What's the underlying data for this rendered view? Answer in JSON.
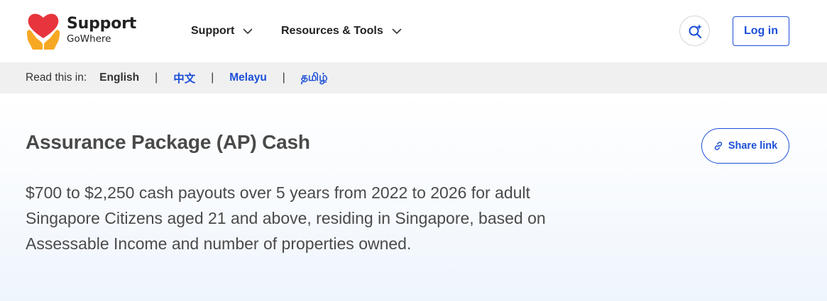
{
  "header": {
    "logo": {
      "line1": "Support",
      "line2": "GoWhere"
    },
    "nav": [
      {
        "label": "Support"
      },
      {
        "label": "Resources & Tools"
      }
    ],
    "login_label": "Log in"
  },
  "language_bar": {
    "label": "Read this in:",
    "current": "English",
    "options": [
      "中文",
      "Melayu",
      "தமிழ்"
    ],
    "separator": "|"
  },
  "main": {
    "title": "Assurance Package (AP) Cash",
    "share_label": "Share link",
    "description": "$700 to $2,250 cash payouts over 5 years from 2022 to 2026 for adult Singapore Citizens aged 21 and above, residing in Singapore, based on Assessable Income and number of properties owned."
  },
  "colors": {
    "accent": "#1c4fd8",
    "heart": "#e8343c",
    "hands": "#f7a823"
  },
  "icons": [
    "heart-hands-logo-icon",
    "chevron-down-icon",
    "search-sparkle-icon",
    "link-icon"
  ]
}
